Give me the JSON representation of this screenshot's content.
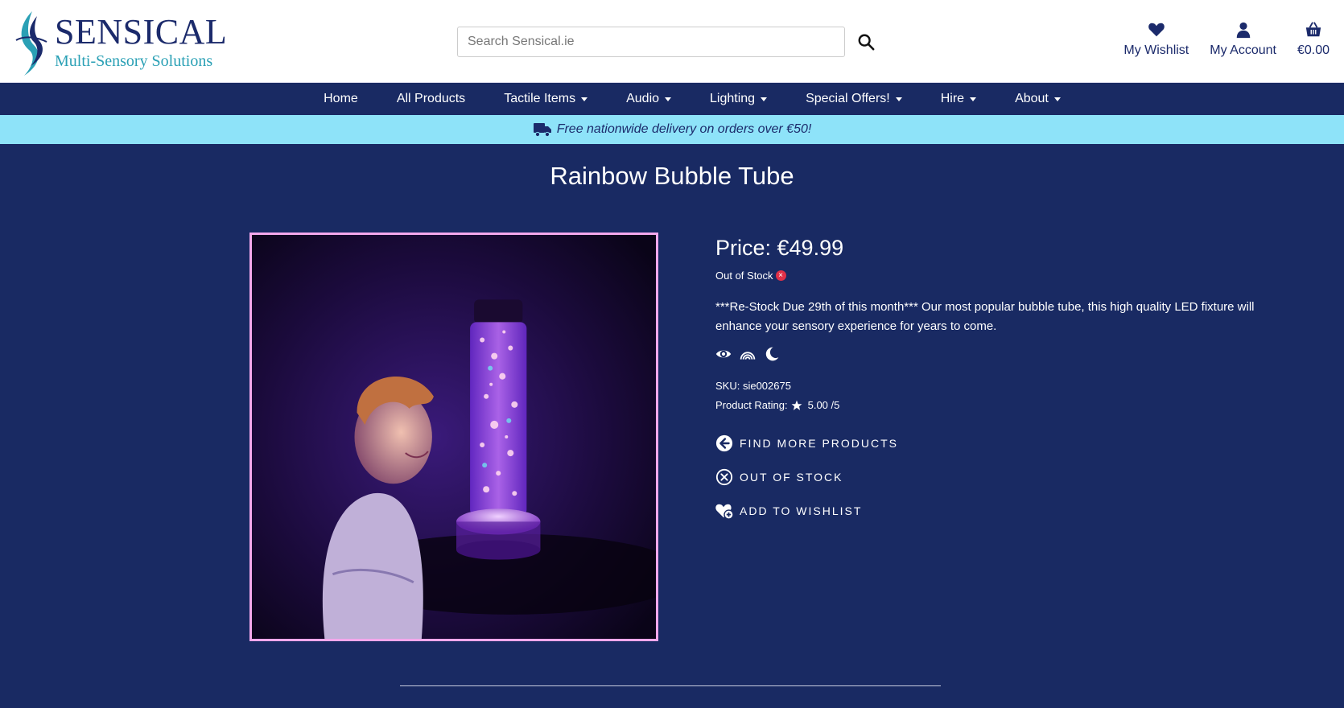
{
  "brand": {
    "name": "SENSICAL",
    "tagline": "Multi-Sensory Solutions"
  },
  "search": {
    "placeholder": "Search Sensical.ie"
  },
  "header_links": {
    "wishlist": "My Wishlist",
    "account": "My Account",
    "basket": "€0.00"
  },
  "nav": {
    "items": [
      {
        "label": "Home"
      },
      {
        "label": "All Products"
      },
      {
        "label": "Tactile Items"
      },
      {
        "label": "Audio"
      },
      {
        "label": "Lighting"
      },
      {
        "label": "Special Offers!"
      },
      {
        "label": "Hire"
      },
      {
        "label": "About"
      }
    ]
  },
  "banner": {
    "text": "Free nationwide delivery on orders over €50!"
  },
  "product": {
    "title": "Rainbow Bubble Tube",
    "price": "Price: €49.99",
    "stock_status": "Out of Stock",
    "description": "***Re-Stock Due 29th of this month*** Our most popular bubble tube, this high quality LED fixture will enhance your sensory experience for years to come.",
    "sku": "SKU: sie002675",
    "rating_label": "Product Rating:",
    "rating_value": "5.00 /5"
  },
  "actions": {
    "find_more": "Find More Products",
    "out_of_stock": "Out of Stock",
    "add_to_wishlist": "Add to Wishlist"
  },
  "colors": {
    "navy": "#192a63",
    "banner": "#8ee3f9",
    "frame": "#f4a8ec",
    "alert": "#e03048"
  },
  "icons": {
    "search": "search-icon",
    "wishlist": "heart-icon",
    "account": "user-icon",
    "basket": "basket-icon",
    "delivery": "truck-icon",
    "senses": [
      "eye-icon",
      "rainbow-icon",
      "moon-icon"
    ],
    "rating": "star-icon"
  }
}
